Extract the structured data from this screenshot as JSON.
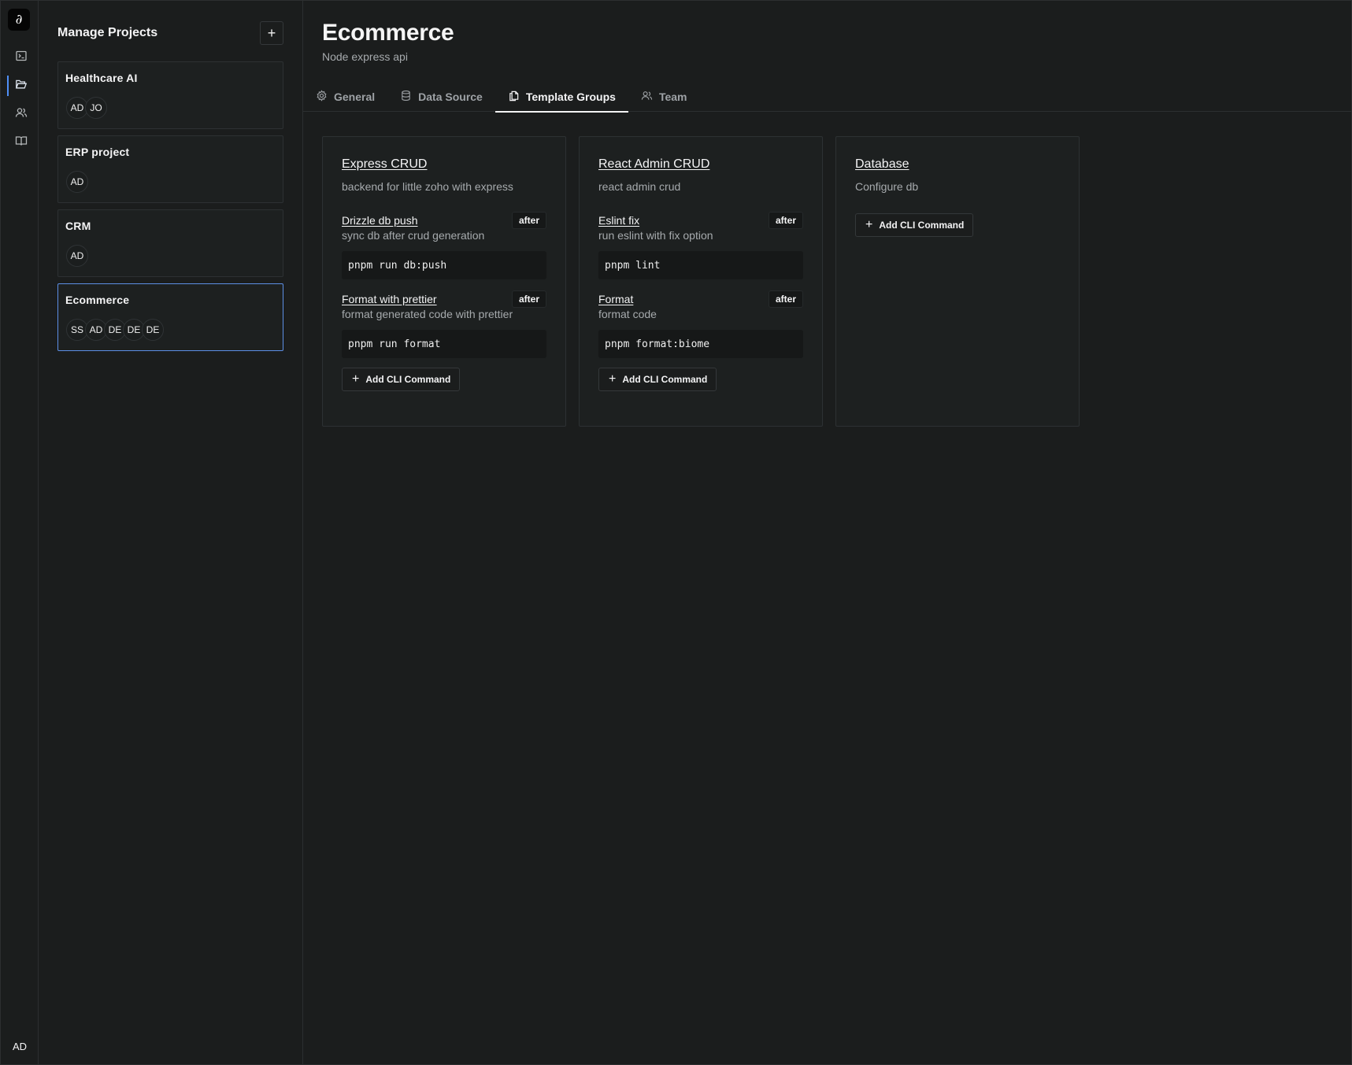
{
  "rail": {
    "logo_glyph": "∂",
    "items": [
      "terminal-icon",
      "folder-open-icon",
      "users-icon",
      "book-open-icon"
    ],
    "active_index": 1,
    "user_initials": "AD"
  },
  "sidebar": {
    "title": "Manage Projects",
    "add_label": "+",
    "projects": [
      {
        "name": "Healthcare AI",
        "members": [
          "AD",
          "JO"
        ],
        "active": false
      },
      {
        "name": "ERP project",
        "members": [
          "AD"
        ],
        "active": false
      },
      {
        "name": "CRM",
        "members": [
          "AD"
        ],
        "active": false
      },
      {
        "name": "Ecommerce",
        "members": [
          "SS",
          "AD",
          "DE",
          "DE",
          "DE"
        ],
        "active": true
      }
    ]
  },
  "main": {
    "title": "Ecommerce",
    "subtitle": "Node express api",
    "tabs": [
      {
        "label": "General",
        "icon": "gear-icon"
      },
      {
        "label": "Data Source",
        "icon": "database-icon"
      },
      {
        "label": "Template Groups",
        "icon": "copy-icon",
        "active": true
      },
      {
        "label": "Team",
        "icon": "users-icon"
      }
    ],
    "groups": [
      {
        "title": "Express CRUD",
        "description": "backend for little zoho with express",
        "commands": [
          {
            "name": "Drizzle db push",
            "badge": "after",
            "description": "sync db after crud generation",
            "code": "pnpm run db:push"
          },
          {
            "name": "Format with prettier",
            "badge": "after",
            "description": "format generated code with prettier",
            "code": "pnpm run format"
          }
        ],
        "add_label": "Add CLI Command"
      },
      {
        "title": "React Admin CRUD",
        "description": "react admin crud",
        "commands": [
          {
            "name": "Eslint fix",
            "badge": "after",
            "description": "run eslint with fix option",
            "code": "pnpm lint"
          },
          {
            "name": "Format",
            "badge": "after",
            "description": "format code",
            "code": "pnpm format:biome"
          }
        ],
        "add_label": "Add CLI Command"
      },
      {
        "title": "Database",
        "description": "Configure db",
        "commands": [],
        "add_label": "Add CLI Command"
      }
    ]
  },
  "colors": {
    "background": "#1b1d1d",
    "accent": "#4f8ff7",
    "card_border": "#2d3133",
    "muted_text": "#a6aaad"
  }
}
